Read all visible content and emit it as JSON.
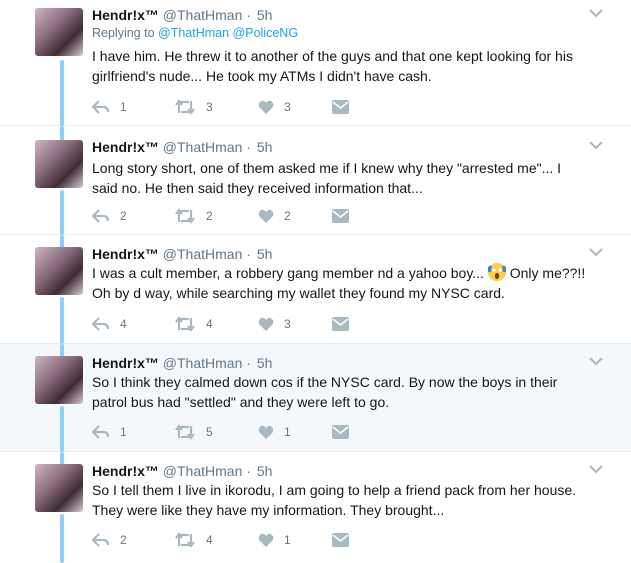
{
  "tweets": [
    {
      "name": "Hendr!x™",
      "handle": "@ThatHman",
      "dot": "·",
      "time": "5h",
      "reply_label": "Replying to",
      "reply_users": [
        "@ThatHman",
        "@PoliceNG"
      ],
      "text_lines": [
        "I have him. He threw it to another of the guys and that one kept looking for his",
        "girlfriend's nude... He took my ATMs I didn't have cash."
      ],
      "replies": "1",
      "retweets": "3",
      "likes": "3"
    },
    {
      "name": "Hendr!x™",
      "handle": "@ThatHman",
      "dot": "·",
      "time": "5h",
      "text_lines": [
        "Long story short, one of them asked me if I knew why they \"arrested me\"... I",
        "said no. He then said they received information that..."
      ],
      "replies": "2",
      "retweets": "2",
      "likes": "2"
    },
    {
      "name": "Hendr!x™",
      "handle": "@ThatHman",
      "dot": "·",
      "time": "5h",
      "text_before_emoji": "I was a cult member, a robbery gang member nd a yahoo boy...",
      "emoji": "face-screaming-emoji",
      "text_after_emoji": "Only me??!!",
      "text_line2": "Oh by d way, while searching my wallet they found my NYSC card.",
      "replies": "4",
      "retweets": "4",
      "likes": "3"
    },
    {
      "name": "Hendr!x™",
      "handle": "@ThatHman",
      "dot": "·",
      "time": "5h",
      "text_lines": [
        "So I think they calmed down cos if the NYSC card. By now the boys in their",
        "patrol bus had \"settled\" and they were left to go."
      ],
      "replies": "1",
      "retweets": "5",
      "likes": "1"
    },
    {
      "name": "Hendr!x™",
      "handle": "@ThatHman",
      "dot": "·",
      "time": "5h",
      "text_lines": [
        "So I tell them I live in ikorodu, I am going to help a friend pack from her house.",
        "They were like they have my information. They brought..."
      ],
      "replies": "2",
      "retweets": "4",
      "likes": "1"
    }
  ],
  "colors": {
    "thread_line": "#8ed0f9",
    "link": "#1da1f2",
    "muted": "#657786",
    "icon": "#aab8c2",
    "highlight_bg": "#f5f8fa"
  },
  "icons": [
    "reply-icon",
    "retweet-icon",
    "heart-icon",
    "message-icon",
    "chevron-down-icon"
  ]
}
